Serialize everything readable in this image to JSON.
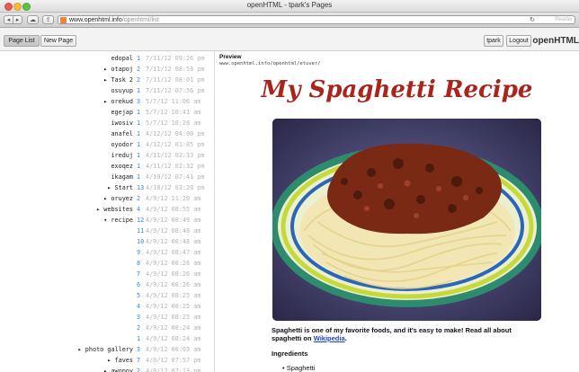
{
  "window": {
    "title": "openHTML - tpark's Pages"
  },
  "browser": {
    "url_host": "www.openhtml.info",
    "url_path": "/openhtml/list",
    "reader_label": "Reader"
  },
  "header": {
    "page_list_label": "Page List",
    "new_page_label": "New Page",
    "user_label": "tpark",
    "logout_label": "Logout",
    "brand": "openHTML"
  },
  "pages": [
    {
      "name": "edopal",
      "count": "1",
      "date": "7/11/12 09:26 pm"
    },
    {
      "name": "▸ otapoj",
      "count": "2",
      "date": "7/11/12 08:53 pm"
    },
    {
      "name": "▸ Task 2",
      "count": "2",
      "date": "7/11/12 08:01 pm"
    },
    {
      "name": "osuyup",
      "count": "1",
      "date": "7/11/12 07:56 pm"
    },
    {
      "name": "▸ orekud",
      "count": "3",
      "date": "5/7/12 11:06 am"
    },
    {
      "name": "egejap",
      "count": "1",
      "date": "5/7/12 10:41 am"
    },
    {
      "name": "iwosiv",
      "count": "1",
      "date": "5/7/12 10:28 am"
    },
    {
      "name": "anafel",
      "count": "1",
      "date": "4/12/12 04:00 pm"
    },
    {
      "name": "oyodor",
      "count": "1",
      "date": "4/12/12 01:05 pm"
    },
    {
      "name": "ireduj",
      "count": "1",
      "date": "4/11/12 02:33 pm"
    },
    {
      "name": "exoqez",
      "count": "1",
      "date": "4/11/12 02:32 pm"
    },
    {
      "name": "ikagam",
      "count": "1",
      "date": "4/10/12 07:41 pm"
    },
    {
      "name": "▸ Start",
      "count": "13",
      "date": "4/10/12 03:20 pm"
    },
    {
      "name": "▸ oruyez",
      "count": "2",
      "date": "4/9/12 11:20 am"
    },
    {
      "name": "▸ websites",
      "count": "4",
      "date": "4/9/12 08:55 am"
    },
    {
      "name": "▾ recipe",
      "count": "12",
      "date": "4/9/12 08:49 am"
    },
    {
      "name": "",
      "count": "11",
      "date": "4/9/12 08:48 am"
    },
    {
      "name": "",
      "count": "10",
      "date": "4/9/12 08:48 am"
    },
    {
      "name": "",
      "count": "9",
      "date": "4/9/12 08:47 am"
    },
    {
      "name": "",
      "count": "8",
      "date": "4/9/12 08:28 am"
    },
    {
      "name": "",
      "count": "7",
      "date": "4/9/12 08:26 am"
    },
    {
      "name": "",
      "count": "6",
      "date": "4/9/12 08:26 am"
    },
    {
      "name": "",
      "count": "5",
      "date": "4/9/12 08:25 am"
    },
    {
      "name": "",
      "count": "4",
      "date": "4/9/12 08:25 am"
    },
    {
      "name": "",
      "count": "3",
      "date": "4/9/12 08:25 am"
    },
    {
      "name": "",
      "count": "2",
      "date": "4/9/12 08:24 am"
    },
    {
      "name": "",
      "count": "1",
      "date": "4/9/12 08:24 am"
    },
    {
      "name": "▸ photo gallery",
      "count": "3",
      "date": "4/9/12 08:03 am"
    },
    {
      "name": "▸ faves",
      "count": "7",
      "date": "4/8/12 07:57 pm"
    },
    {
      "name": "▸ awopoy",
      "count": "2",
      "date": "4/8/12 07:13 pm"
    }
  ],
  "preview": {
    "label": "Preview",
    "url": "www.openhtml.info/openhtml/etuver/",
    "recipe_title": "My Spaghetti Recipe",
    "intro_text": "Spaghetti is one of my favorite foods, and it's easy to make! Read all about spaghetti on",
    "link_text": "Wikipedia",
    "link_suffix": ".",
    "ingredients_heading": "Ingredients",
    "first_ingredient": "Spaghetti"
  },
  "colors": {
    "accent_count": "#3a86d6",
    "recipe_title": "#a8241c",
    "link": "#1a3fd6"
  }
}
